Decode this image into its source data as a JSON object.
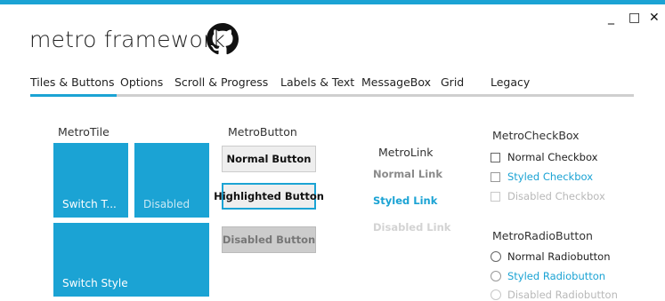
{
  "window": {
    "title": "metro framework",
    "controls": {
      "minimize": "_",
      "maximize": "□",
      "close": "✕"
    },
    "accent": "#1ba3d4"
  },
  "tabs": [
    "Tiles & Buttons",
    "Options",
    "Scroll & Progress",
    "Labels & Text",
    "MessageBox",
    "Grid",
    "Legacy"
  ],
  "tiles": {
    "label": "MetroTile",
    "items": [
      "Switch T...",
      "Disabled",
      "Switch Style"
    ]
  },
  "buttons": {
    "label": "MetroButton",
    "items": [
      "Normal Button",
      "Highlighted Button",
      "Disabled Button"
    ]
  },
  "links": {
    "label": "MetroLink",
    "items": [
      "Normal Link",
      "Styled Link",
      "Disabled Link"
    ]
  },
  "checkboxes": {
    "label": "MetroCheckBox",
    "items": [
      "Normal Checkbox",
      "Styled Checkbox",
      "Disabled Checkbox"
    ]
  },
  "radios": {
    "label": "MetroRadioButton",
    "items": [
      "Normal Radiobutton",
      "Styled Radiobutton",
      "Disabled Radiobutton"
    ]
  },
  "colors": {
    "accent": "#1ba3d4",
    "disabled_text": "#b8b8b8",
    "link_normal": "#8a8a8a"
  }
}
